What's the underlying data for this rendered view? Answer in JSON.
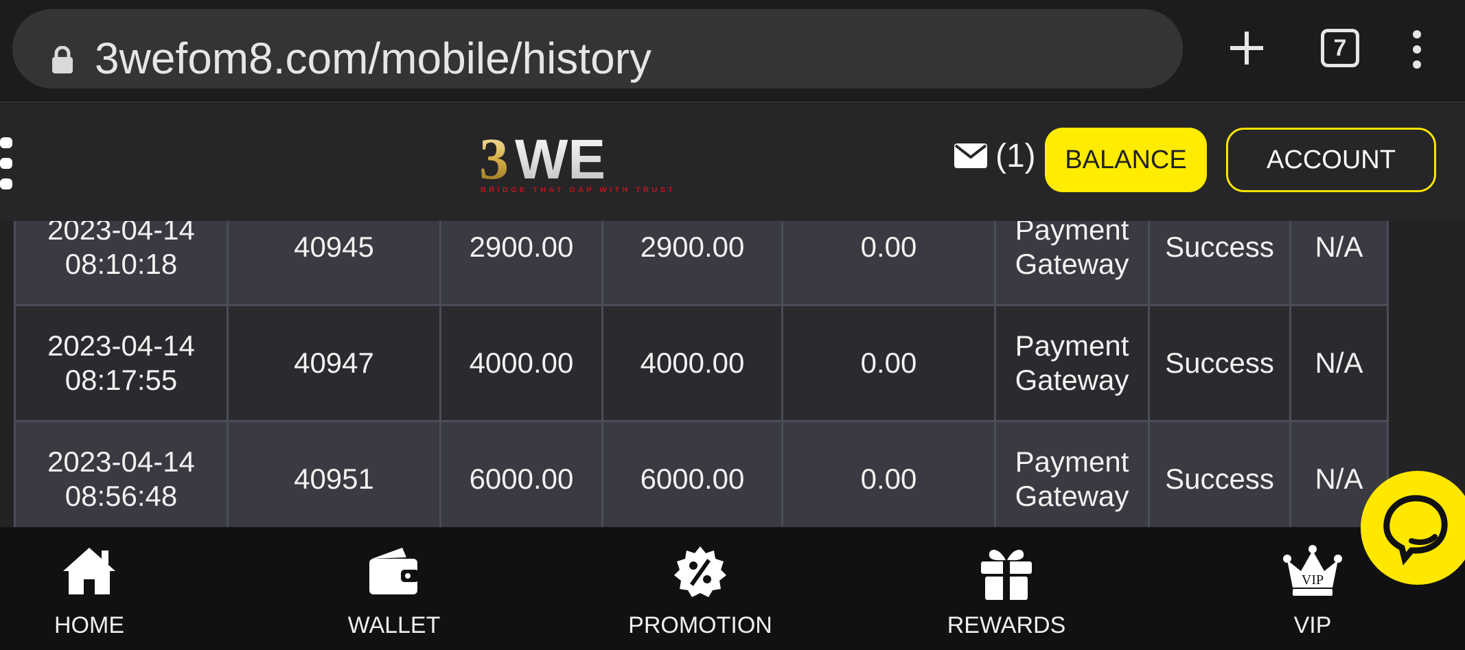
{
  "browser": {
    "url": "3wefom8.com/mobile/history",
    "tab_count": "7"
  },
  "header": {
    "logo_text": "3WE",
    "logo_tagline": "BRIDGE THAT GAP WITH TRUST",
    "mail_count": "(1)",
    "balance_label": "BALANCE",
    "account_label": "ACCOUNT"
  },
  "history": {
    "rows": [
      {
        "date": "2023-04-14",
        "time": "08:10:18",
        "id": "40945",
        "amount": "2900.00",
        "credited": "2900.00",
        "fee": "0.00",
        "method_line1": "Payment",
        "method_line2": "Gateway",
        "status": "Success",
        "remark": "N/A"
      },
      {
        "date": "2023-04-14",
        "time": "08:17:55",
        "id": "40947",
        "amount": "4000.00",
        "credited": "4000.00",
        "fee": "0.00",
        "method_line1": "Payment",
        "method_line2": "Gateway",
        "status": "Success",
        "remark": "N/A"
      },
      {
        "date": "2023-04-14",
        "time": "08:56:48",
        "id": "40951",
        "amount": "6000.00",
        "credited": "6000.00",
        "fee": "0.00",
        "method_line1": "Payment",
        "method_line2": "Gateway",
        "status": "Success",
        "remark": "N/A"
      }
    ]
  },
  "bottom_nav": {
    "items": [
      {
        "label": "HOME",
        "icon": "home-icon"
      },
      {
        "label": "WALLET",
        "icon": "wallet-icon"
      },
      {
        "label": "PROMOTION",
        "icon": "promotion-icon"
      },
      {
        "label": "REWARDS",
        "icon": "gift-icon"
      },
      {
        "label": "VIP",
        "icon": "crown-icon",
        "badge": "VIP"
      }
    ]
  },
  "colors": {
    "accent": "#ffec00",
    "background": "#1d1d1f",
    "row_alt": "#3a3a42",
    "row_base": "#2b2b2f"
  }
}
